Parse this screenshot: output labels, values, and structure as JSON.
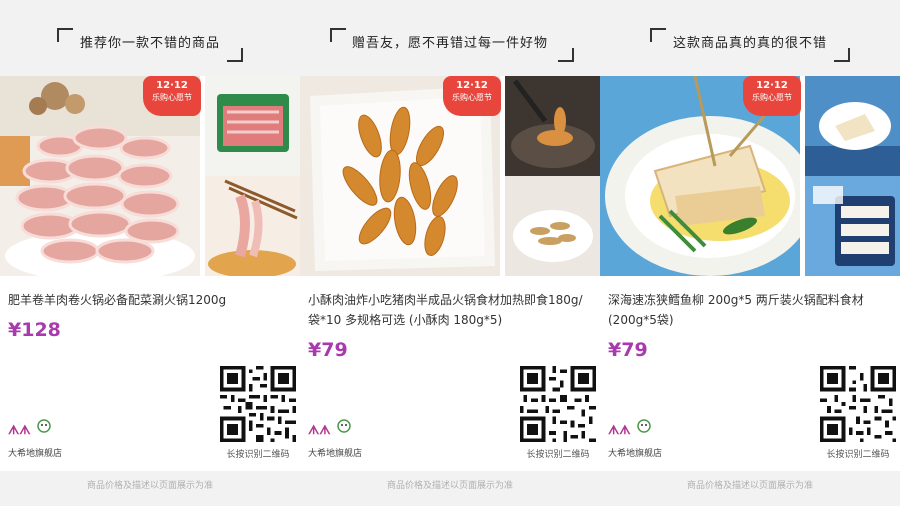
{
  "products": [
    {
      "slogan": "推荐你一款不错的商品",
      "badge_line1": "12·12",
      "badge_line2": "乐购心愿节",
      "title": "肥羊卷羊肉卷火锅必备配菜涮火锅1200g",
      "price": "¥128",
      "store_name": "大希地旗舰店",
      "qr_label": "长按识别二维码",
      "footer": "商品价格及描述以页面展示为准"
    },
    {
      "slogan": "赠吾友，愿不再错过每一件好物",
      "badge_line1": "12·12",
      "badge_line2": "乐购心愿节",
      "title": "小酥肉油炸小吃猪肉半成品火锅食材加热即食180g/袋*10 多规格可选 (小酥肉 180g*5)",
      "price": "¥79",
      "store_name": "大希地旗舰店",
      "qr_label": "长按识别二维码",
      "footer": "商品价格及描述以页面展示为准"
    },
    {
      "slogan": "这款商品真的真的很不错",
      "badge_line1": "12·12",
      "badge_line2": "乐购心愿节",
      "title": "深海速冻狭鳕鱼柳 200g*5 两斤装火锅配料食材 (200g*5袋)",
      "price": "¥79",
      "store_name": "大希地旗舰店",
      "qr_label": "长按识别二维码",
      "footer": "商品价格及描述以页面展示为准"
    }
  ],
  "colors": {
    "price": "#a93aae",
    "badge": "#e8453c",
    "background": "#f2f2f2"
  }
}
